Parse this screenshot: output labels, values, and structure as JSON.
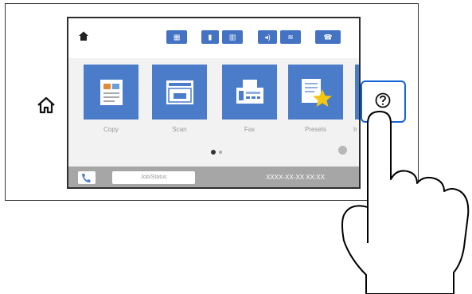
{
  "tiles": [
    {
      "label": "Copy",
      "icon": "copy-icon"
    },
    {
      "label": "Scan",
      "icon": "scan-icon"
    },
    {
      "label": "Fax",
      "icon": "fax-icon"
    },
    {
      "label": "Presets",
      "icon": "presets-icon"
    },
    {
      "label": "Ir",
      "icon": "partial-tile"
    }
  ],
  "bottom": {
    "job_status": "Job/Status",
    "datetime": "XXXX-XX-XX XX:XX"
  },
  "colors": {
    "tile_blue": "#4a7cc9",
    "highlight_blue": "#1663d6",
    "star_yellow": "#f3c614"
  }
}
